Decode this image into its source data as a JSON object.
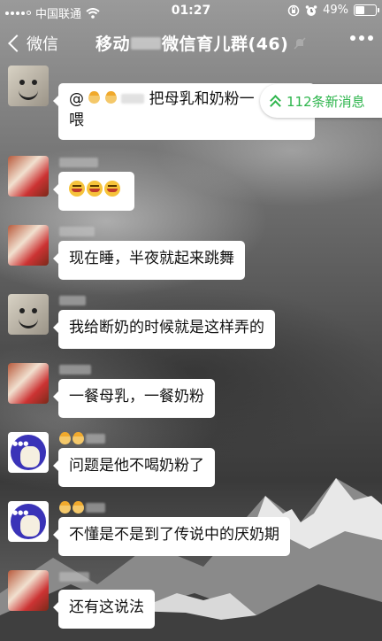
{
  "status_bar": {
    "carrier": "中国联通",
    "time": "01:27",
    "battery_percent": "49%",
    "battery_level": 0.49,
    "icons": [
      "signal-icon",
      "wifi-icon",
      "orientation-lock-icon",
      "alarm-icon",
      "battery-icon"
    ]
  },
  "nav": {
    "back_label": "微信",
    "title_prefix": "移动",
    "title_suffix": "微信育儿群(46)",
    "icons": [
      "back-chevron-icon",
      "mute-icon",
      "more-icon"
    ]
  },
  "new_messages": {
    "label": "112条新消息"
  },
  "messages": [
    {
      "avatar": "avatar-snowman",
      "text_prefix": "@",
      "text": "把母乳和奶粉一",
      "text_line2": "喂"
    },
    {
      "avatar": "avatar-girl",
      "emoji": [
        "cry-laugh-emoji",
        "cry-laugh-emoji",
        "cry-laugh-emoji"
      ]
    },
    {
      "avatar": "avatar-girl",
      "text": "现在睡，半夜就起来跳舞"
    },
    {
      "avatar": "avatar-snowman",
      "text": "我给断奶的时候就是这样弄的"
    },
    {
      "avatar": "avatar-girl",
      "text": "一餐母乳，一餐奶粉"
    },
    {
      "avatar": "avatar-cartoon",
      "text": "问题是他不喝奶粉了"
    },
    {
      "avatar": "avatar-cartoon",
      "text": "不懂是不是到了传说中的厌奶期"
    },
    {
      "avatar": "avatar-girl",
      "text": "还有这说法"
    }
  ]
}
